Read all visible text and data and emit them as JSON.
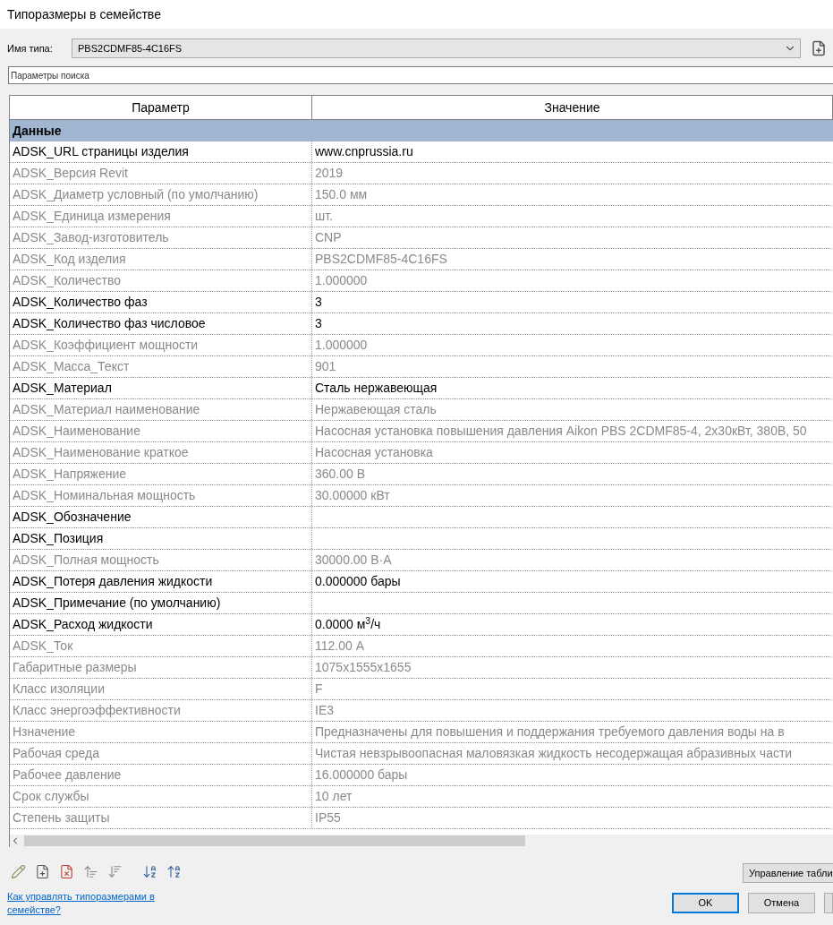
{
  "window": {
    "title": "Типоразмеры в семействе"
  },
  "type_name": {
    "label": "Имя типа:",
    "value": "PBS2CDMF85-4C16FS"
  },
  "search": {
    "placeholder": "Параметры поиска"
  },
  "table": {
    "columns": [
      "Параметр",
      "Значение"
    ],
    "group": "Данные",
    "rows": [
      {
        "name": "ADSK_URL страницы изделия",
        "value": "www.cnprussia.ru",
        "disabled": false
      },
      {
        "name": "ADSK_Версия Revit",
        "value": "2019",
        "disabled": true
      },
      {
        "name": "ADSK_Диаметр условный (по умолчанию)",
        "value": "150.0 мм",
        "disabled": true
      },
      {
        "name": "ADSK_Единица измерения",
        "value": "шт.",
        "disabled": true
      },
      {
        "name": "ADSK_Завод-изготовитель",
        "value": "CNP",
        "disabled": true
      },
      {
        "name": "ADSK_Код изделия",
        "value": "PBS2CDMF85-4C16FS",
        "disabled": true
      },
      {
        "name": "ADSK_Количество",
        "value": "1.000000",
        "disabled": true
      },
      {
        "name": "ADSK_Количество фаз",
        "value": "3",
        "disabled": false
      },
      {
        "name": "ADSK_Количество фаз числовое",
        "value": "3",
        "disabled": false
      },
      {
        "name": "ADSK_Коэффициент мощности",
        "value": "1.000000",
        "disabled": true
      },
      {
        "name": "ADSK_Масса_Текст",
        "value": "901",
        "disabled": true
      },
      {
        "name": "ADSK_Материал",
        "value": "Сталь нержавеющая",
        "disabled": false
      },
      {
        "name": "ADSK_Материал наименование",
        "value": "Нержавеющая сталь",
        "disabled": true
      },
      {
        "name": "ADSK_Наименование",
        "value": "Насосная установка повышения давления Aikon PBS 2CDMF85-4, 2x30кВт, 380В, 50",
        "disabled": true
      },
      {
        "name": "ADSK_Наименование краткое",
        "value": "Насосная установка",
        "disabled": true
      },
      {
        "name": "ADSK_Напряжение",
        "value": "360.00 В",
        "disabled": true
      },
      {
        "name": "ADSK_Номинальная мощность",
        "value": "30.00000 кВт",
        "disabled": true
      },
      {
        "name": "ADSK_Обозначение",
        "disabled": false
      },
      {
        "name": "ADSK_Позиция",
        "disabled": false
      },
      {
        "name": "ADSK_Полная мощность",
        "value": "30000.00 В·А",
        "disabled": true
      },
      {
        "name": "ADSK_Потеря давления жидкости",
        "value": "0.000000 бары",
        "disabled": false
      },
      {
        "name": "ADSK_Примечание (по умолчанию)",
        "disabled": false
      },
      {
        "name": "ADSK_Расход жидкости",
        "value": "0.0000 м$^{3}$/ч",
        "disabled": false
      },
      {
        "name": "ADSK_Ток",
        "value": "112.00 А",
        "disabled": true
      },
      {
        "name": "Габаритные размеры",
        "value": "1075x1555x1655",
        "disabled": true
      },
      {
        "name": "Класс изоляции",
        "value": "F",
        "disabled": true
      },
      {
        "name": "Класс энергоэффективности",
        "value": "IE3",
        "disabled": true
      },
      {
        "name": "Нзначение",
        "value": "Предназначены для повышения и поддержания требуемого давления воды на в",
        "disabled": true
      },
      {
        "name": "Рабочая среда",
        "value": "Чистая невзрывоопасная маловязкая жидкость несодержащая абразивных части",
        "disabled": true
      },
      {
        "name": "Рабочее давление",
        "value": "16.000000 бары",
        "disabled": true
      },
      {
        "name": "Срок службы",
        "value": "10 лет",
        "disabled": true
      },
      {
        "name": "Степень защиты",
        "value": "IP55",
        "disabled": true
      }
    ]
  },
  "manage_button": {
    "label": "Управление табли"
  },
  "help_link": "Как управлять типоразмерами в семействе?",
  "buttons": [
    "OK",
    "Отмена"
  ]
}
